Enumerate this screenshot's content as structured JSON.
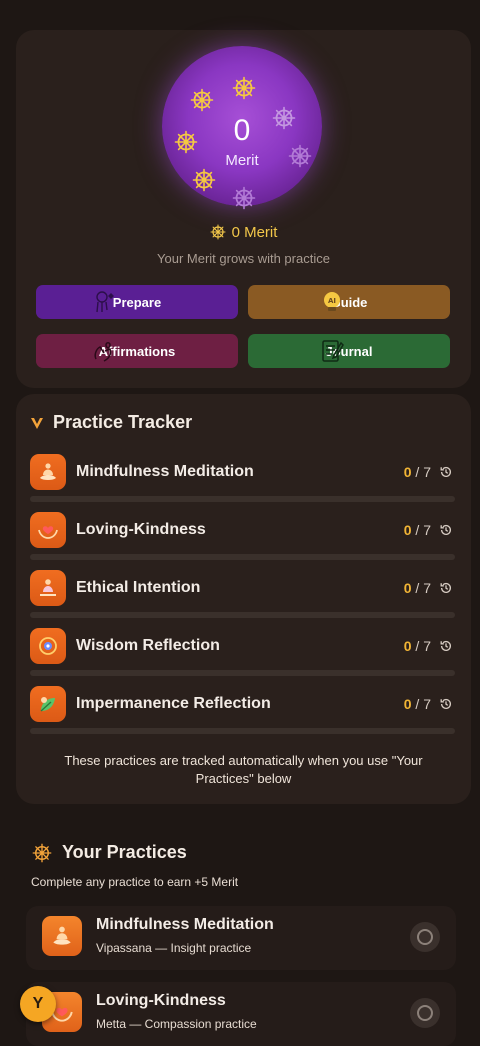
{
  "merit": {
    "count": "0",
    "orb_label": "Merit",
    "total_label": "0 Merit",
    "subtitle": "Your Merit grows with practice"
  },
  "actions": {
    "prepare": "Prepare",
    "guide": "Guide",
    "affirmations": "Affirmations",
    "journal": "Journal"
  },
  "tracker": {
    "title": "Practice Tracker",
    "items": [
      {
        "name": "Mindfulness Meditation",
        "current": "0",
        "total": "/ 7"
      },
      {
        "name": "Loving-Kindness",
        "current": "0",
        "total": "/ 7"
      },
      {
        "name": "Ethical Intention",
        "current": "0",
        "total": "/ 7"
      },
      {
        "name": "Wisdom Reflection",
        "current": "0",
        "total": "/ 7"
      },
      {
        "name": "Impermanence Reflection",
        "current": "0",
        "total": "/ 7"
      }
    ],
    "note": "These practices are tracked automatically when you use \"Your Practices\" below"
  },
  "practices": {
    "title": "Your Practices",
    "subtitle": "Complete any practice to earn +5 Merit",
    "items": [
      {
        "name": "Mindfulness Meditation",
        "desc": "Vipassana — Insight practice"
      },
      {
        "name": "Loving-Kindness",
        "desc": "Metta — Compassion practice"
      }
    ]
  },
  "user": {
    "avatar_initial": "Y"
  },
  "colors": {
    "accent_gold": "#f2c74a",
    "orb_purple": "#8a37c2",
    "prepare": "#5a1f94",
    "guide": "#8a5a23",
    "affirmations": "#6e1f43",
    "journal": "#2b6a35",
    "practice_orange": "#e8631a"
  }
}
